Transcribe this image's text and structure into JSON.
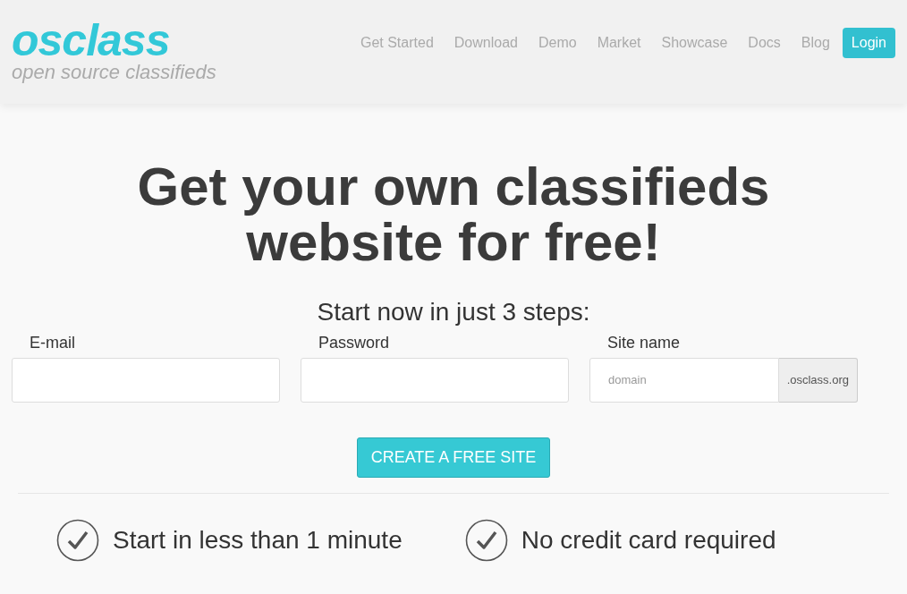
{
  "logo": {
    "name": "osclass",
    "tagline": "open source classifieds"
  },
  "nav": {
    "links": [
      "Get Started",
      "Download",
      "Demo",
      "Market",
      "Showcase",
      "Docs",
      "Blog"
    ],
    "login": "Login"
  },
  "hero": {
    "title_lines": [
      "Get your own classifieds",
      "website for free!"
    ],
    "subtitle": "Start now in just 3 steps:"
  },
  "form": {
    "fields": [
      {
        "kind": "text",
        "label": "E-mail"
      },
      {
        "kind": "text",
        "label": "Password"
      },
      {
        "kind": "addon",
        "label": "Site name",
        "placeholder": "domain",
        "addon": ".osclass.org"
      }
    ],
    "submit": "CREATE A FREE SITE"
  },
  "features": [
    "Start in less than 1 minute",
    "No credit card required"
  ]
}
